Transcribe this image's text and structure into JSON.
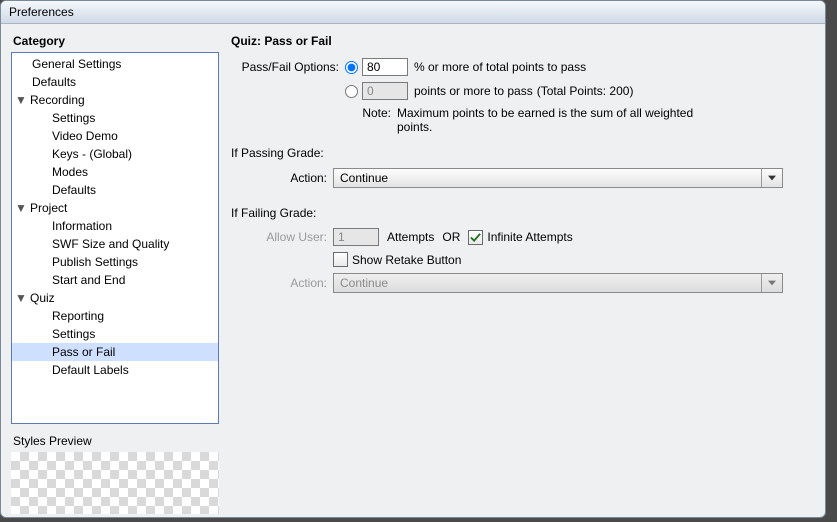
{
  "window": {
    "title": "Preferences"
  },
  "category": {
    "title": "Category"
  },
  "tree": {
    "general_settings": "General Settings",
    "defaults_top": "Defaults",
    "recording": "Recording",
    "recording_children": {
      "settings": "Settings",
      "video_demo": "Video Demo",
      "keys_global": "Keys - (Global)",
      "modes": "Modes",
      "defaults": "Defaults"
    },
    "project": "Project",
    "project_children": {
      "information": "Information",
      "swf_size": "SWF Size and Quality",
      "publish_settings": "Publish Settings",
      "start_and_end": "Start and End"
    },
    "quiz": "Quiz",
    "quiz_children": {
      "reporting": "Reporting",
      "settings": "Settings",
      "pass_or_fail": "Pass or Fail",
      "default_labels": "Default Labels"
    }
  },
  "styles_preview": {
    "title": "Styles Preview"
  },
  "panel": {
    "title": "Quiz: Pass or Fail",
    "passfail_label": "Pass/Fail Options:",
    "percent_value": "80",
    "percent_suffix": "% or more of total points to pass",
    "points_value": "0",
    "points_suffix": "points or more to pass",
    "total_points": "(Total Points: 200)",
    "note_label": "Note:",
    "note_text": "Maximum points to be earned is the sum of all weighted points.",
    "if_passing": "If Passing Grade:",
    "action_label": "Action:",
    "passing_action_value": "Continue",
    "if_failing": "If Failing Grade:",
    "allow_user_label": "Allow User:",
    "attempts_value": "1",
    "attempts_word": "Attempts",
    "or_word": "OR",
    "infinite_attempts": "Infinite Attempts",
    "show_retake": "Show Retake Button",
    "failing_action_value": "Continue"
  }
}
